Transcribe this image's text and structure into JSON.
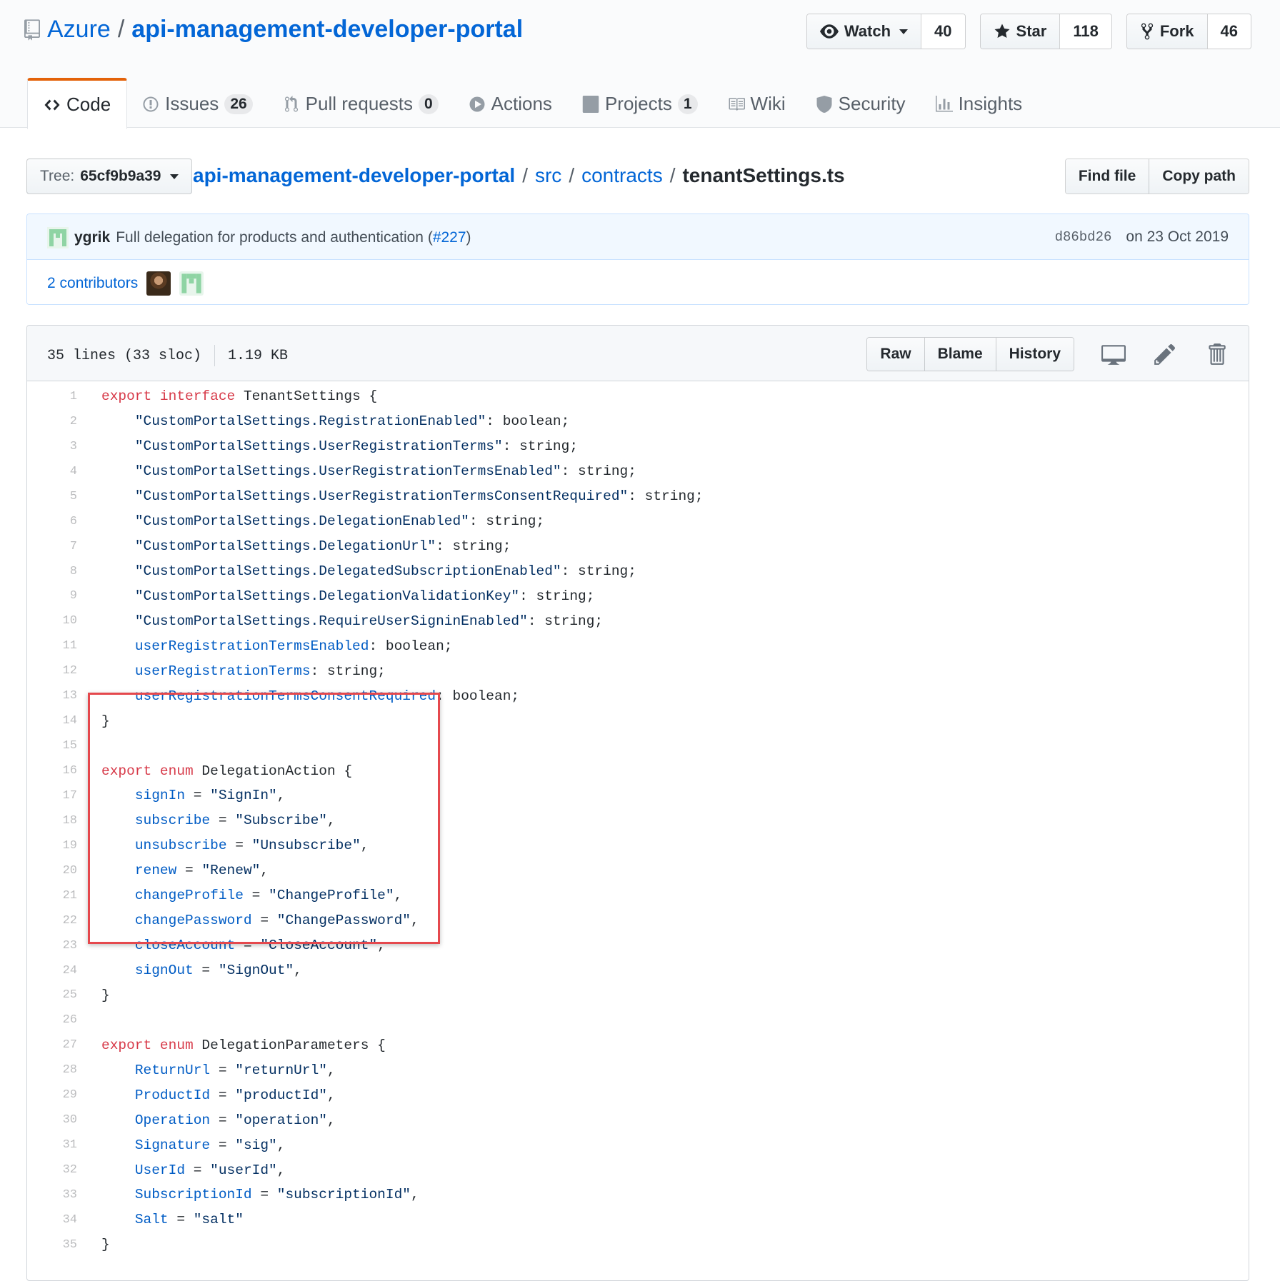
{
  "repo": {
    "owner": "Azure",
    "separator": "/",
    "name": "api-management-developer-portal"
  },
  "actions": {
    "watch": {
      "label": "Watch",
      "count": "40"
    },
    "star": {
      "label": "Star",
      "count": "118"
    },
    "fork": {
      "label": "Fork",
      "count": "46"
    }
  },
  "tabs": [
    {
      "label": "Code",
      "icon": "code-icon",
      "selected": true
    },
    {
      "label": "Issues",
      "icon": "issue-icon",
      "count": "26"
    },
    {
      "label": "Pull requests",
      "icon": "pull-request-icon",
      "count": "0"
    },
    {
      "label": "Actions",
      "icon": "play-icon"
    },
    {
      "label": "Projects",
      "icon": "project-icon",
      "count": "1"
    },
    {
      "label": "Wiki",
      "icon": "book-icon"
    },
    {
      "label": "Security",
      "icon": "shield-icon"
    },
    {
      "label": "Insights",
      "icon": "graph-icon"
    }
  ],
  "breadcrumb": {
    "tree_label": "Tree:",
    "tree_value": "65cf9b9a39",
    "root": "api-management-developer-portal",
    "segments": [
      "src",
      "contracts"
    ],
    "separator": "/",
    "file": "tenantSettings.ts",
    "find_file": "Find file",
    "copy_path": "Copy path"
  },
  "commit": {
    "author": "ygrik",
    "message": "Full delegation for products and authentication (",
    "issue": "#227",
    "message_end": ")",
    "sha": "d86bd26",
    "date": "on 23 Oct 2019",
    "contributors": "2 contributors"
  },
  "file": {
    "lines_info": "35 lines (33 sloc)",
    "size": "1.19 KB",
    "raw": "Raw",
    "blame": "Blame",
    "history": "History"
  },
  "code_lines": [
    [
      [
        "kw",
        "export"
      ],
      [
        "p",
        " "
      ],
      [
        "kw",
        "interface"
      ],
      [
        "p",
        " TenantSettings {"
      ]
    ],
    [
      [
        "p",
        "    "
      ],
      [
        "str",
        "\"CustomPortalSettings.RegistrationEnabled\""
      ],
      [
        "p",
        ": boolean;"
      ]
    ],
    [
      [
        "p",
        "    "
      ],
      [
        "str",
        "\"CustomPortalSettings.UserRegistrationTerms\""
      ],
      [
        "p",
        ": string;"
      ]
    ],
    [
      [
        "p",
        "    "
      ],
      [
        "str",
        "\"CustomPortalSettings.UserRegistrationTermsEnabled\""
      ],
      [
        "p",
        ": string;"
      ]
    ],
    [
      [
        "p",
        "    "
      ],
      [
        "str",
        "\"CustomPortalSettings.UserRegistrationTermsConsentRequired\""
      ],
      [
        "p",
        ": string;"
      ]
    ],
    [
      [
        "p",
        "    "
      ],
      [
        "str",
        "\"CustomPortalSettings.DelegationEnabled\""
      ],
      [
        "p",
        ": string;"
      ]
    ],
    [
      [
        "p",
        "    "
      ],
      [
        "str",
        "\"CustomPortalSettings.DelegationUrl\""
      ],
      [
        "p",
        ": string;"
      ]
    ],
    [
      [
        "p",
        "    "
      ],
      [
        "str",
        "\"CustomPortalSettings.DelegatedSubscriptionEnabled\""
      ],
      [
        "p",
        ": string;"
      ]
    ],
    [
      [
        "p",
        "    "
      ],
      [
        "str",
        "\"CustomPortalSettings.DelegationValidationKey\""
      ],
      [
        "p",
        ": string;"
      ]
    ],
    [
      [
        "p",
        "    "
      ],
      [
        "str",
        "\"CustomPortalSettings.RequireUserSigninEnabled\""
      ],
      [
        "p",
        ": string;"
      ]
    ],
    [
      [
        "p",
        "    "
      ],
      [
        "prop",
        "userRegistrationTermsEnabled"
      ],
      [
        "p",
        ": boolean;"
      ]
    ],
    [
      [
        "p",
        "    "
      ],
      [
        "prop",
        "userRegistrationTerms"
      ],
      [
        "p",
        ": string;"
      ]
    ],
    [
      [
        "p",
        "    "
      ],
      [
        "prop",
        "userRegistrationTermsConsentRequired"
      ],
      [
        "p",
        ": boolean;"
      ]
    ],
    [
      [
        "p",
        "}"
      ]
    ],
    [],
    [
      [
        "kw",
        "export"
      ],
      [
        "p",
        " "
      ],
      [
        "kw",
        "enum"
      ],
      [
        "p",
        " DelegationAction {"
      ]
    ],
    [
      [
        "p",
        "    "
      ],
      [
        "prop",
        "signIn"
      ],
      [
        "p",
        " = "
      ],
      [
        "str",
        "\"SignIn\""
      ],
      [
        "p",
        ","
      ]
    ],
    [
      [
        "p",
        "    "
      ],
      [
        "prop",
        "subscribe"
      ],
      [
        "p",
        " = "
      ],
      [
        "str",
        "\"Subscribe\""
      ],
      [
        "p",
        ","
      ]
    ],
    [
      [
        "p",
        "    "
      ],
      [
        "prop",
        "unsubscribe"
      ],
      [
        "p",
        " = "
      ],
      [
        "str",
        "\"Unsubscribe\""
      ],
      [
        "p",
        ","
      ]
    ],
    [
      [
        "p",
        "    "
      ],
      [
        "prop",
        "renew"
      ],
      [
        "p",
        " = "
      ],
      [
        "str",
        "\"Renew\""
      ],
      [
        "p",
        ","
      ]
    ],
    [
      [
        "p",
        "    "
      ],
      [
        "prop",
        "changeProfile"
      ],
      [
        "p",
        " = "
      ],
      [
        "str",
        "\"ChangeProfile\""
      ],
      [
        "p",
        ","
      ]
    ],
    [
      [
        "p",
        "    "
      ],
      [
        "prop",
        "changePassword"
      ],
      [
        "p",
        " = "
      ],
      [
        "str",
        "\"ChangePassword\""
      ],
      [
        "p",
        ","
      ]
    ],
    [
      [
        "p",
        "    "
      ],
      [
        "prop",
        "closeAccount"
      ],
      [
        "p",
        " = "
      ],
      [
        "str",
        "\"CloseAccount\""
      ],
      [
        "p",
        ","
      ]
    ],
    [
      [
        "p",
        "    "
      ],
      [
        "prop",
        "signOut"
      ],
      [
        "p",
        " = "
      ],
      [
        "str",
        "\"SignOut\""
      ],
      [
        "p",
        ","
      ]
    ],
    [
      [
        "p",
        "}"
      ]
    ],
    [],
    [
      [
        "kw",
        "export"
      ],
      [
        "p",
        " "
      ],
      [
        "kw",
        "enum"
      ],
      [
        "p",
        " DelegationParameters {"
      ]
    ],
    [
      [
        "p",
        "    "
      ],
      [
        "prop",
        "ReturnUrl"
      ],
      [
        "p",
        " = "
      ],
      [
        "str",
        "\"returnUrl\""
      ],
      [
        "p",
        ","
      ]
    ],
    [
      [
        "p",
        "    "
      ],
      [
        "prop",
        "ProductId"
      ],
      [
        "p",
        " = "
      ],
      [
        "str",
        "\"productId\""
      ],
      [
        "p",
        ","
      ]
    ],
    [
      [
        "p",
        "    "
      ],
      [
        "prop",
        "Operation"
      ],
      [
        "p",
        " = "
      ],
      [
        "str",
        "\"operation\""
      ],
      [
        "p",
        ","
      ]
    ],
    [
      [
        "p",
        "    "
      ],
      [
        "prop",
        "Signature"
      ],
      [
        "p",
        " = "
      ],
      [
        "str",
        "\"sig\""
      ],
      [
        "p",
        ","
      ]
    ],
    [
      [
        "p",
        "    "
      ],
      [
        "prop",
        "UserId"
      ],
      [
        "p",
        " = "
      ],
      [
        "str",
        "\"userId\""
      ],
      [
        "p",
        ","
      ]
    ],
    [
      [
        "p",
        "    "
      ],
      [
        "prop",
        "SubscriptionId"
      ],
      [
        "p",
        " = "
      ],
      [
        "str",
        "\"subscriptionId\""
      ],
      [
        "p",
        ","
      ]
    ],
    [
      [
        "p",
        "    "
      ],
      [
        "prop",
        "Salt"
      ],
      [
        "p",
        " = "
      ],
      [
        "str",
        "\"salt\""
      ]
    ],
    [
      [
        "p",
        "}"
      ]
    ]
  ],
  "colors": {
    "link": "#0366d6",
    "keyword": "#d73a49",
    "string": "#032f62",
    "property": "#005cc5",
    "selected_tab_accent": "#e36209",
    "highlight_box": "#e5484d"
  }
}
